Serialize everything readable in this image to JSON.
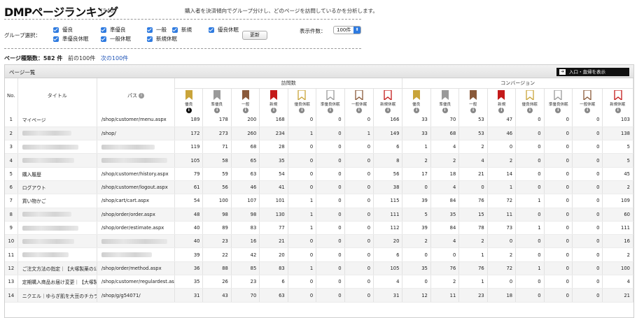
{
  "header": {
    "title": "DMPページランキング",
    "count": "[540]",
    "description": "購入者を決済傾向でグループ分けし、どのページを訪問しているかを分析します。"
  },
  "filters": {
    "label": "グループ選択：",
    "checkboxes": [
      {
        "label": "優良",
        "checked": true
      },
      {
        "label": "準優良",
        "checked": true
      },
      {
        "label": "一般",
        "checked": true
      },
      {
        "label": "新規",
        "checked": true
      },
      {
        "label": "優良休眠",
        "checked": true
      },
      {
        "label": "準優良休眠",
        "checked": true
      },
      {
        "label": "一般休眠",
        "checked": true
      },
      {
        "label": "新規休眠",
        "checked": true
      }
    ],
    "update_label": "更新",
    "display_label": "表示件数：",
    "display_value": "100件"
  },
  "page_info": {
    "kinds_label": "ページ種類数：",
    "kinds_value": "582 件",
    "prev_label": "前の100件",
    "next_label": "次の100件"
  },
  "panel": {
    "title": "ページ一覧",
    "entry_button": "入口・直帰を表示",
    "col_no": "No.",
    "col_title": "タイトル",
    "col_path": "パス",
    "group_visits": "訪問数",
    "group_conversion": "コンバージョン",
    "ranks": [
      {
        "label": "優良",
        "color": "#c9a43a"
      },
      {
        "label": "準優良",
        "color": "#9a9a9a"
      },
      {
        "label": "一般",
        "color": "#8a5a3a"
      },
      {
        "label": "新規",
        "color": "#c41a1a"
      },
      {
        "label": "優良休眠",
        "color": "#c9a43a"
      },
      {
        "label": "準優良休眠",
        "color": "#9a9a9a"
      },
      {
        "label": "一般休眠",
        "color": "#8a5a3a"
      },
      {
        "label": "新規休眠",
        "color": "#c41a1a"
      }
    ]
  },
  "rows": [
    {
      "no": "1",
      "title": "マイページ",
      "path": "/shop/customer/menu.aspx",
      "visits": [
        "189",
        "178",
        "200",
        "168",
        "0",
        "0",
        "0",
        "166"
      ],
      "conv": [
        "33",
        "70",
        "53",
        "47",
        "0",
        "0",
        "0",
        "103"
      ]
    },
    {
      "no": "2",
      "title": "",
      "path": "/shop/",
      "visits": [
        "172",
        "273",
        "260",
        "234",
        "1",
        "0",
        "1",
        "149"
      ],
      "conv": [
        "33",
        "68",
        "53",
        "46",
        "0",
        "0",
        "0",
        "138"
      ]
    },
    {
      "no": "3",
      "title": "",
      "path": "",
      "visits": [
        "119",
        "71",
        "68",
        "28",
        "0",
        "0",
        "0",
        "6"
      ],
      "conv": [
        "1",
        "4",
        "2",
        "0",
        "0",
        "0",
        "0",
        "5"
      ]
    },
    {
      "no": "4",
      "title": "",
      "path": "",
      "visits": [
        "105",
        "58",
        "65",
        "35",
        "0",
        "0",
        "0",
        "8"
      ],
      "conv": [
        "2",
        "2",
        "4",
        "2",
        "0",
        "0",
        "0",
        "5"
      ]
    },
    {
      "no": "5",
      "title": "購入履歴",
      "path": "/shop/customer/history.aspx",
      "visits": [
        "79",
        "59",
        "63",
        "54",
        "0",
        "0",
        "0",
        "56"
      ],
      "conv": [
        "17",
        "18",
        "21",
        "14",
        "0",
        "0",
        "0",
        "45"
      ]
    },
    {
      "no": "6",
      "title": "ログアウト",
      "path": "/shop/customer/logout.aspx",
      "visits": [
        "61",
        "56",
        "46",
        "41",
        "0",
        "0",
        "0",
        "38"
      ],
      "conv": [
        "0",
        "4",
        "0",
        "1",
        "0",
        "0",
        "0",
        "2"
      ]
    },
    {
      "no": "7",
      "title": "買い物かご",
      "path": "/shop/cart/cart.aspx",
      "visits": [
        "54",
        "100",
        "107",
        "101",
        "1",
        "0",
        "0",
        "115"
      ],
      "conv": [
        "39",
        "84",
        "76",
        "72",
        "1",
        "0",
        "0",
        "109"
      ]
    },
    {
      "no": "8",
      "title": "",
      "path": "/shop/order/order.aspx",
      "visits": [
        "48",
        "98",
        "98",
        "130",
        "1",
        "0",
        "0",
        "111"
      ],
      "conv": [
        "5",
        "35",
        "15",
        "11",
        "0",
        "0",
        "0",
        "60"
      ]
    },
    {
      "no": "9",
      "title": "",
      "path": "/shop/order/estimate.aspx",
      "visits": [
        "40",
        "89",
        "83",
        "77",
        "1",
        "0",
        "0",
        "112"
      ],
      "conv": [
        "39",
        "84",
        "78",
        "73",
        "1",
        "0",
        "0",
        "111"
      ]
    },
    {
      "no": "10",
      "title": "",
      "path": "",
      "visits": [
        "40",
        "23",
        "16",
        "21",
        "0",
        "0",
        "0",
        "20"
      ],
      "conv": [
        "2",
        "4",
        "2",
        "0",
        "0",
        "0",
        "0",
        "16"
      ]
    },
    {
      "no": "11",
      "title": "",
      "path": "",
      "visits": [
        "39",
        "22",
        "42",
        "20",
        "0",
        "0",
        "0",
        "6"
      ],
      "conv": [
        "0",
        "0",
        "1",
        "2",
        "0",
        "0",
        "0",
        "2"
      ]
    },
    {
      "no": "12",
      "title": "ご注文方法の指定｜【大塚製薬の公式...",
      "path": "/shop/order/method.aspx",
      "visits": [
        "36",
        "88",
        "85",
        "83",
        "1",
        "0",
        "0",
        "105"
      ],
      "conv": [
        "35",
        "76",
        "76",
        "72",
        "1",
        "0",
        "0",
        "100"
      ]
    },
    {
      "no": "13",
      "title": "定期購入商品お届け変更｜【大塚製薬...",
      "path": "/shop/customer/regulardest.aspx",
      "visits": [
        "35",
        "26",
        "23",
        "6",
        "0",
        "0",
        "0",
        "4"
      ],
      "conv": [
        "0",
        "2",
        "1",
        "0",
        "0",
        "0",
        "0",
        "4"
      ]
    },
    {
      "no": "14",
      "title": "ニクエル｜ゆらぎ肌を大豆のチカラで...",
      "path": "/shop/g/g54071/",
      "visits": [
        "31",
        "43",
        "70",
        "63",
        "0",
        "0",
        "0",
        "31"
      ],
      "conv": [
        "12",
        "11",
        "23",
        "18",
        "0",
        "0",
        "0",
        "21"
      ]
    }
  ]
}
